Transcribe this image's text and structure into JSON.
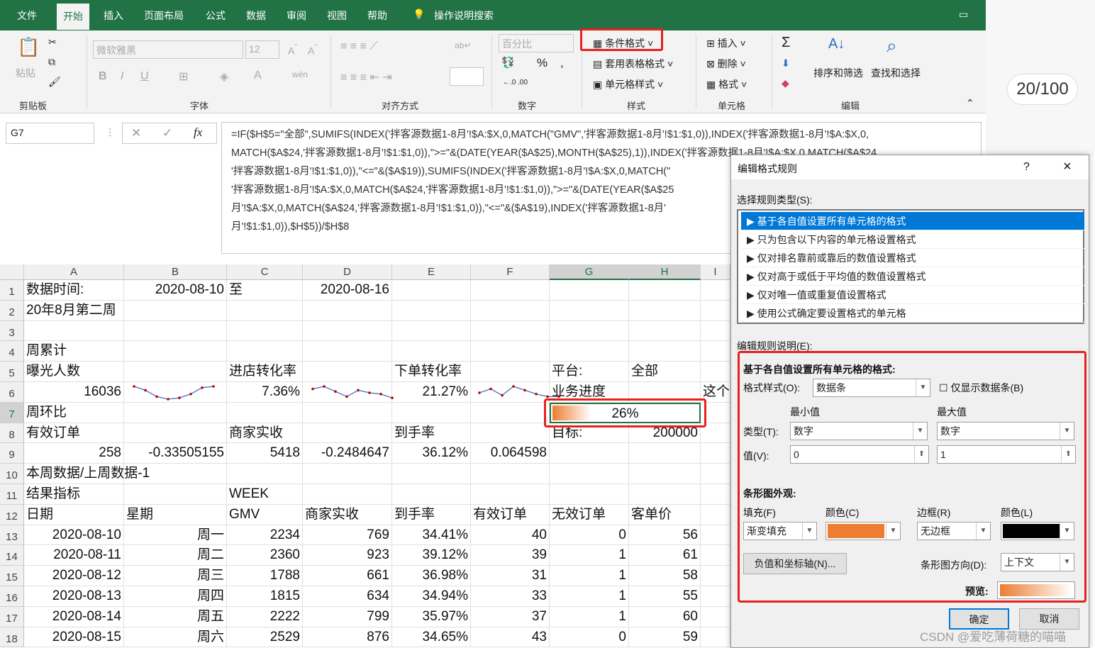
{
  "tabs": [
    "文件",
    "开始",
    "插入",
    "页面布局",
    "公式",
    "数据",
    "审阅",
    "视图",
    "帮助",
    "操作说明搜索"
  ],
  "ribbon": {
    "paste": "粘贴",
    "clipboard": "剪贴板",
    "font_name": "微软雅黑",
    "font_size": "12",
    "font": "字体",
    "align": "对齐方式",
    "number_format": "百分比",
    "number": "数字",
    "cond_format": "条件格式",
    "table_format": "套用表格格式",
    "cell_style": "单元格样式",
    "styles": "样式",
    "insert": "插入",
    "delete": "删除",
    "format": "格式",
    "cells": "单元格",
    "sort": "排序和筛选",
    "find": "查找和选择",
    "edit": "编辑",
    "bold": "B",
    "italic": "I",
    "underline": "U"
  },
  "accent": "#217346",
  "name_box": "G7",
  "formula_lines": [
    "=IF($H$5=\"全部\",SUMIFS(INDEX('拌客源数据1-8月'!$A:$X,0,MATCH(\"GMV\",'拌客源数据1-8月'!$1:$1,0)),INDEX('拌客源数据1-8月'!$A:$X,0,",
    "MATCH($A$24,'拌客源数据1-8月'!$1:$1,0)),\">=\"&(DATE(YEAR($A$25),MONTH($A$25),1)),INDEX('拌客源数据1-8月'!$A:$X,0,MATCH($A$24,",
    "'拌客源数据1-8月'!$1:$1,0)),\"<=\"&($A$19)),SUMIFS(INDEX('拌客源数据1-8月'!$A:$X,0,MATCH(\"",
    "'拌客源数据1-8月'!$A:$X,0,MATCH($A$24,'拌客源数据1-8月'!$1:$1,0)),\">=\"&(DATE(YEAR($A$25",
    "月'!$A:$X,0,MATCH($A$24,'拌客源数据1-8月'!$1:$1,0)),\"<=\"&($A$19),INDEX('拌客源数据1-8月'",
    "月'!$1:$1,0)),$H$5))/$H$8"
  ],
  "side_counter": "20/100",
  "columns": [
    "A",
    "B",
    "C",
    "D",
    "E",
    "F",
    "G",
    "H",
    "I"
  ],
  "rows": [
    [
      "数据时间:",
      "2020-08-10",
      "至",
      "2020-08-16",
      "",
      "",
      "",
      "",
      ""
    ],
    [
      "20年8月第二周",
      "",
      "",
      "",
      "",
      "",
      "",
      "",
      ""
    ],
    [
      "",
      "",
      "",
      "",
      "",
      "",
      "",
      "",
      ""
    ],
    [
      "周累计",
      "",
      "",
      "",
      "",
      "",
      "",
      "",
      ""
    ],
    [
      "曝光人数",
      "",
      "进店转化率",
      "",
      "下单转化率",
      "",
      "平台:",
      "全部",
      ""
    ],
    [
      "16036",
      "",
      "7.36%",
      "",
      "21.27%",
      "",
      "业务进度",
      "",
      "这个"
    ],
    [
      "周环比",
      "",
      "",
      "",
      "",
      "",
      "",
      "",
      ""
    ],
    [
      "有效订单",
      "",
      "商家实收",
      "",
      "到手率",
      "",
      "目标:",
      "200000",
      ""
    ],
    [
      "258",
      "-0.33505155",
      "5418",
      "-0.2484647",
      "36.12%",
      "0.064598",
      "",
      "",
      ""
    ],
    [
      "本周数据/上周数据-1",
      "",
      "",
      "",
      "",
      "",
      "",
      "",
      ""
    ],
    [
      "结果指标",
      "",
      "WEEK",
      "",
      "",
      "",
      "",
      "",
      ""
    ],
    [
      "日期",
      "星期",
      "GMV",
      "商家实收",
      "到手率",
      "有效订单",
      "无效订单",
      "客单价",
      ""
    ],
    [
      "2020-08-10",
      "周一",
      "2234",
      "769",
      "34.41%",
      "40",
      "0",
      "56",
      ""
    ],
    [
      "2020-08-11",
      "周二",
      "2360",
      "923",
      "39.12%",
      "39",
      "1",
      "61",
      ""
    ],
    [
      "2020-08-12",
      "周三",
      "1788",
      "661",
      "36.98%",
      "31",
      "1",
      "58",
      ""
    ],
    [
      "2020-08-13",
      "周四",
      "1815",
      "634",
      "34.94%",
      "33",
      "1",
      "55",
      ""
    ],
    [
      "2020-08-14",
      "周五",
      "2222",
      "799",
      "35.97%",
      "37",
      "1",
      "60",
      ""
    ],
    [
      "2020-08-15",
      "周六",
      "2529",
      "876",
      "34.65%",
      "43",
      "0",
      "59",
      ""
    ]
  ],
  "databar": {
    "label": "26%",
    "value": 0.26,
    "color": "#ED7D31"
  },
  "dialog": {
    "title": "编辑格式规则",
    "help": "?",
    "close": "×",
    "rule_type_label": "选择规则类型(S):",
    "rule_types": [
      "基于各自值设置所有单元格的格式",
      "只为包含以下内容的单元格设置格式",
      "仅对排名靠前或靠后的数值设置格式",
      "仅对高于或低于平均值的数值设置格式",
      "仅对唯一值或重复值设置格式",
      "使用公式确定要设置格式的单元格"
    ],
    "desc_label": "编辑规则说明(E):",
    "desc_title": "基于各自值设置所有单元格的格式:",
    "style_label": "格式样式(O):",
    "style_value": "数据条",
    "bar_only": "仅显示数据条(B)",
    "min": "最小值",
    "max": "最大值",
    "type_label": "类型(T):",
    "min_type": "数字",
    "max_type": "数字",
    "value_label": "值(V):",
    "min_value": "0",
    "max_value": "1",
    "appearance": "条形图外观:",
    "fill_label": "填充(F)",
    "fill_value": "渐变填充",
    "color_label": "颜色(C)",
    "fill_color": "#ED7D31",
    "border_label": "边框(R)",
    "border_value": "无边框",
    "border_color_label": "颜色(L)",
    "border_color": "#000000",
    "neg_button": "负值和坐标轴(N)...",
    "direction_label": "条形图方向(D):",
    "direction_value": "上下文",
    "preview_label": "预览:",
    "ok": "确定",
    "cancel": "取消"
  },
  "watermark": "CSDN @爱吃薄荷糖的喵喵"
}
